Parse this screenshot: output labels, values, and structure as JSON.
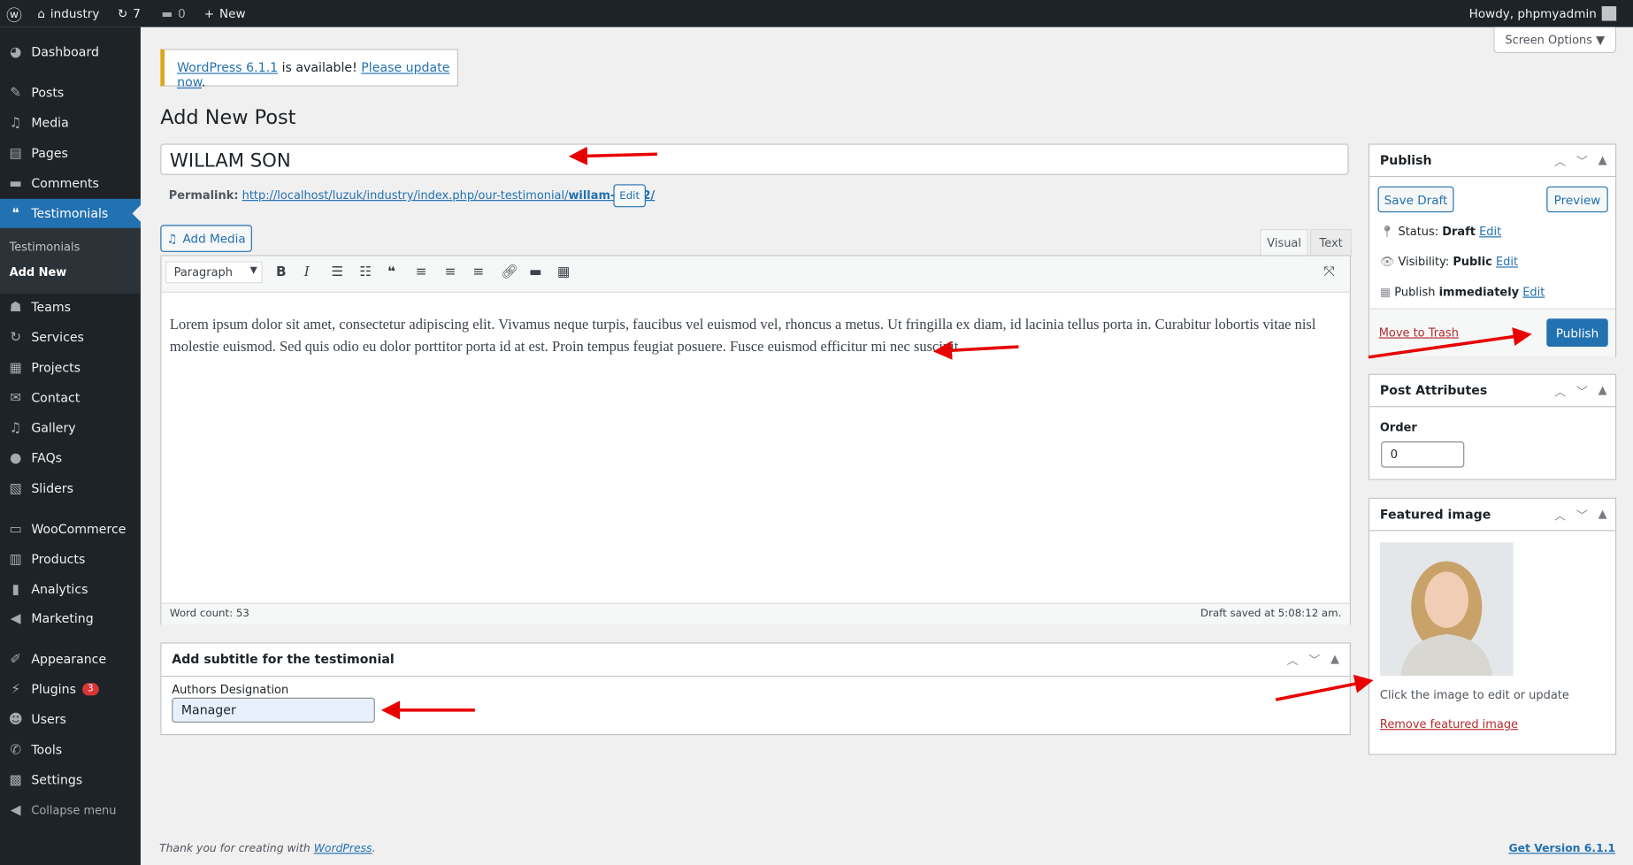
{
  "adminbar": {
    "site": "industry",
    "updates": "7",
    "comments": "0",
    "new": "New",
    "howdy": "Howdy, phpmyadmin"
  },
  "sidebar": {
    "items": [
      {
        "label": "Dashboard",
        "icon": "dashboard-icon",
        "g": "◕"
      },
      {
        "label": "Posts",
        "icon": "pin-icon",
        "g": "✎"
      },
      {
        "label": "Media",
        "icon": "media-icon",
        "g": "♫"
      },
      {
        "label": "Pages",
        "icon": "pages-icon",
        "g": "▤"
      },
      {
        "label": "Comments",
        "icon": "comment-icon",
        "g": "▬"
      },
      {
        "label": "Testimonials",
        "icon": "testimonial-icon",
        "g": "❝"
      },
      {
        "label": "Teams",
        "icon": "teams-icon",
        "g": "☗"
      },
      {
        "label": "Services",
        "icon": "services-icon",
        "g": "↻"
      },
      {
        "label": "Projects",
        "icon": "projects-icon",
        "g": "▦"
      },
      {
        "label": "Contact",
        "icon": "mail-icon",
        "g": "✉"
      },
      {
        "label": "Gallery",
        "icon": "gallery-icon",
        "g": "♫"
      },
      {
        "label": "FAQs",
        "icon": "faq-icon",
        "g": "●"
      },
      {
        "label": "Sliders",
        "icon": "sliders-icon",
        "g": "▧"
      },
      {
        "label": "WooCommerce",
        "icon": "woo-icon",
        "g": "▭"
      },
      {
        "label": "Products",
        "icon": "products-icon",
        "g": "▥"
      },
      {
        "label": "Analytics",
        "icon": "analytics-icon",
        "g": "▮"
      },
      {
        "label": "Marketing",
        "icon": "megaphone-icon",
        "g": "◀"
      },
      {
        "label": "Appearance",
        "icon": "brush-icon",
        "g": "✐"
      },
      {
        "label": "Plugins",
        "icon": "plugin-icon",
        "g": "⚡",
        "badge": "3"
      },
      {
        "label": "Users",
        "icon": "user-icon",
        "g": "☻"
      },
      {
        "label": "Tools",
        "icon": "wrench-icon",
        "g": "✆"
      },
      {
        "label": "Settings",
        "icon": "settings-icon",
        "g": "▩"
      }
    ],
    "submenu": [
      "Testimonials",
      "Add New"
    ],
    "collapse": "Collapse menu"
  },
  "notice": {
    "link1": "WordPress 6.1.1",
    "text": " is available! ",
    "link2": "Please update now",
    "end": "."
  },
  "screen_options": "Screen Options ▼",
  "page_title": "Add New Post",
  "post_title": "WILLAM SON",
  "permalink": {
    "label": "Permalink:",
    "url": "http://localhost/luzuk/industry/index.php/our-testimonial/",
    "slug": "willam-son-2/",
    "edit": "Edit"
  },
  "editor": {
    "add_media": "Add Media",
    "tab_visual": "Visual",
    "tab_text": "Text",
    "format": "Paragraph",
    "content": "Lorem ipsum dolor sit amet, consectetur adipiscing elit. Vivamus neque turpis, faucibus vel euismod vel, rhoncus a metus. Ut fringilla ex diam, id lacinia tellus porta in. Curabitur lobortis vitae nisl molestie euismod. Sed quis odio eu dolor porttitor porta id at est. Proin tempus feugiat posuere. Fusce euismod efficitur mi nec suscipit.",
    "word_count": "Word count: 53",
    "draft_saved": "Draft saved at 5:08:12 am."
  },
  "subtitle_box": {
    "title": "Add subtitle for the testimonial",
    "label": "Authors Designation",
    "value": "Manager"
  },
  "publish": {
    "title": "Publish",
    "save_draft": "Save Draft",
    "preview": "Preview",
    "status_label": "Status: ",
    "status": "Draft",
    "visibility_label": "Visibility: ",
    "visibility": "Public",
    "publish_label": "Publish ",
    "publish_when": "immediately",
    "edit": "Edit",
    "trash": "Move to Trash",
    "publish_btn": "Publish"
  },
  "attributes": {
    "title": "Post Attributes",
    "order_label": "Order",
    "order": "0"
  },
  "featured": {
    "title": "Featured image",
    "hint": "Click the image to edit or update",
    "remove": "Remove featured image"
  },
  "footer": {
    "thanks": "Thank you for creating with ",
    "wp": "WordPress",
    "end": ".",
    "version": "Get Version 6.1.1"
  },
  "colors": {
    "accent": "#2271b1",
    "adminbar": "#1d2327",
    "annotation": "#e80000"
  }
}
